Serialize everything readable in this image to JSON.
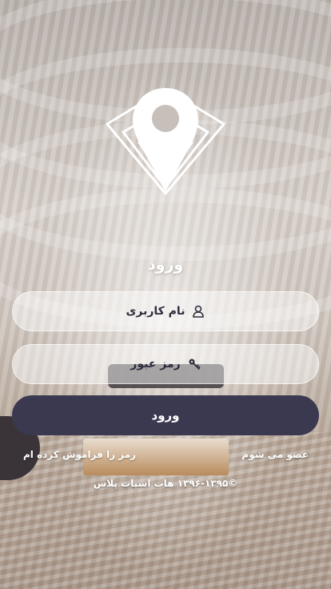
{
  "login": {
    "title": "ورود",
    "username_placeholder": "نام کاربری",
    "password_placeholder": "رمز عبور",
    "submit_label": "ورود",
    "register_link": "عضو می شوم",
    "forgot_link": "رمز را فراموش کرده ام",
    "copyright": "©۱۳۹۶-۱۳۹۵ هات اسپات پلاس"
  },
  "icons": {
    "logo": "map-pin-wifi-logo",
    "username": "user-icon",
    "password": "key-icon"
  },
  "colors": {
    "button": "#3b3950",
    "text_on_field": "#2f2d3c",
    "white": "#ffffff"
  }
}
